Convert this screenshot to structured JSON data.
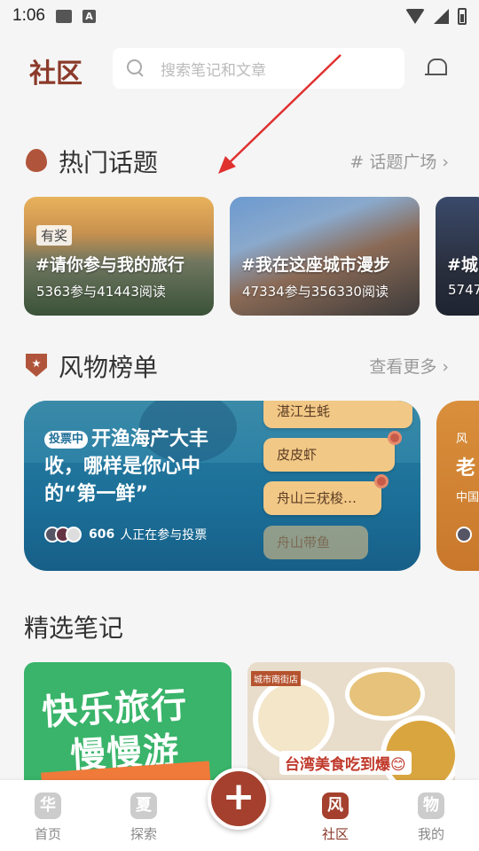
{
  "status_bar": {
    "time": "1:06",
    "notif_icons": [
      "image-icon",
      "a-icon"
    ],
    "right_icons": [
      "wifi-icon",
      "signal-icon",
      "battery-charging-icon"
    ]
  },
  "header": {
    "title": "社区",
    "search_placeholder": "搜索笔记和文章"
  },
  "hot_topics": {
    "title": "热门话题",
    "more": "# 话题广场 ›",
    "cards": [
      {
        "badge": "有奖",
        "title": "#请你参与我的旅行",
        "stats": "5363参与41443阅读"
      },
      {
        "title": "#我在这座城市漫步",
        "stats": "47334参与356330阅读"
      },
      {
        "title": "#城",
        "stats": "5747"
      }
    ]
  },
  "rankings": {
    "title": "风物榜单",
    "more": "查看更多 ›",
    "card1": {
      "badge": "投票中",
      "text": "开渔海产大丰收，哪样是你心中的“第一鲜”",
      "participants": "606",
      "participants_suffix": "人正在参与投票",
      "options": [
        "湛江生蚝",
        "皮皮虾",
        "舟山三疣梭…",
        "舟山带鱼"
      ]
    },
    "card2": {
      "line1": "风",
      "line2": "老",
      "line3": "中国"
    }
  },
  "notes": {
    "title": "精选笔记",
    "note1": {
      "line1": "快乐旅行",
      "line2": "慢慢游"
    },
    "note2": {
      "tag": "台湾美食吃到爆😊",
      "top_label": "城市南街店"
    }
  },
  "tabbar": {
    "items": [
      {
        "label": "首页",
        "glyph": "华"
      },
      {
        "label": "探索",
        "glyph": "夏"
      },
      {
        "label": "社区",
        "glyph": "风"
      },
      {
        "label": "我的",
        "glyph": "物"
      }
    ],
    "fab": "+"
  },
  "colors": {
    "brand": "#8b3a2a",
    "accent": "#a4402d",
    "banner_blue": "#1b6f98",
    "ticket": "#f2c886"
  }
}
